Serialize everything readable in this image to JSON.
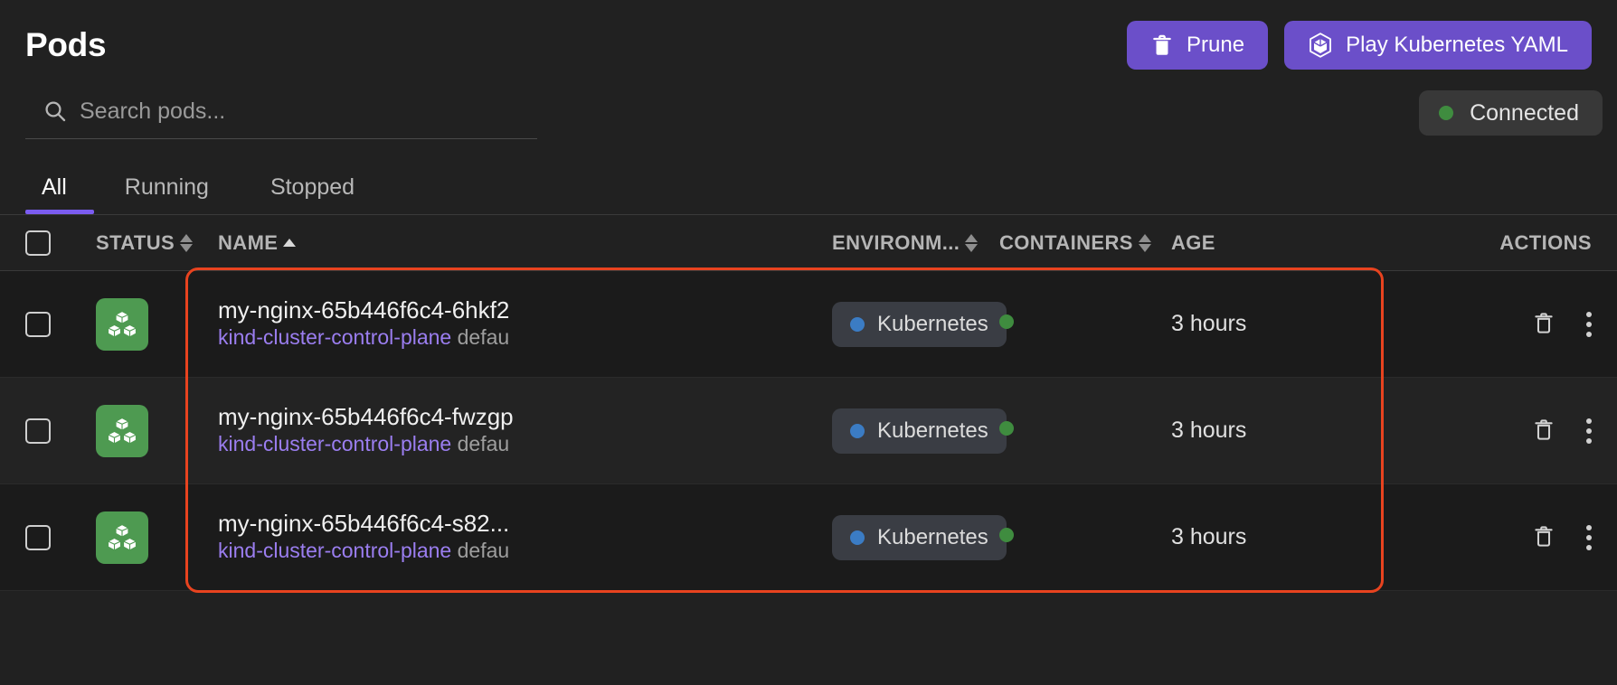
{
  "header": {
    "title": "Pods",
    "prune_label": "Prune",
    "prune_icon": "trash-icon",
    "play_yaml_label": "Play Kubernetes YAML",
    "play_yaml_icon": "cube-icon",
    "accent_color": "#6b4fc9"
  },
  "search": {
    "placeholder": "Search pods...",
    "value": "",
    "icon": "search-icon"
  },
  "connection": {
    "label": "Connected",
    "status_color": "#3f8c3f",
    "dot_icon": "status-dot-icon"
  },
  "tabs": [
    {
      "label": "All",
      "active": true
    },
    {
      "label": "Running",
      "active": false
    },
    {
      "label": "Stopped",
      "active": false
    }
  ],
  "table": {
    "columns": {
      "status": "STATUS",
      "name": "NAME",
      "environment": "ENVIRONM...",
      "containers": "CONTAINERS",
      "age": "AGE",
      "actions": "ACTIONS"
    },
    "sort": {
      "column": "NAME",
      "direction": "asc"
    },
    "select_all_checked": false,
    "rows": [
      {
        "checked": false,
        "status_icon": "pod-cubes-icon",
        "status_color": "#4e9a51",
        "name": "my-nginx-65b446f6c4-6hkf2",
        "namespace": "kind-cluster-control-plane",
        "namespace_extra": "defau",
        "environment": "Kubernetes",
        "environment_dot_color": "#3b7cc4",
        "container_dot_color": "#3f8c3f",
        "age": "3 hours",
        "delete_icon": "trash-icon",
        "menu_icon": "kebab-menu-icon"
      },
      {
        "checked": false,
        "status_icon": "pod-cubes-icon",
        "status_color": "#4e9a51",
        "name": "my-nginx-65b446f6c4-fwzgp",
        "namespace": "kind-cluster-control-plane",
        "namespace_extra": "defau",
        "environment": "Kubernetes",
        "environment_dot_color": "#3b7cc4",
        "container_dot_color": "#3f8c3f",
        "age": "3 hours",
        "delete_icon": "trash-icon",
        "menu_icon": "kebab-menu-icon"
      },
      {
        "checked": false,
        "status_icon": "pod-cubes-icon",
        "status_color": "#4e9a51",
        "name": "my-nginx-65b446f6c4-s82...",
        "namespace": "kind-cluster-control-plane",
        "namespace_extra": "defau",
        "environment": "Kubernetes",
        "environment_dot_color": "#3b7cc4",
        "container_dot_color": "#3f8c3f",
        "age": "3 hours",
        "delete_icon": "trash-icon",
        "menu_icon": "kebab-menu-icon"
      }
    ]
  },
  "highlight": {
    "color": "#e8431f"
  }
}
